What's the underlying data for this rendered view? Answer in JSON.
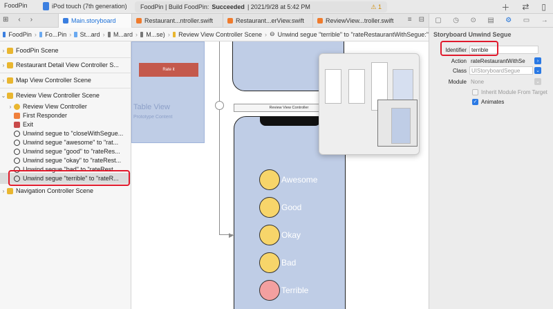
{
  "toolbar": {
    "scheme": "FoodPin",
    "device": "iPod touch (7th generation)",
    "status_prefix": "FoodPin | Build FoodPin:",
    "status_state": "Succeeded",
    "status_time": "| 2021/9/28 at 5:42 PM",
    "warnings": "⚠ 1"
  },
  "tabs": [
    {
      "label": "Main.storyboard",
      "active": true
    },
    {
      "label": "Restaurant...ntroller.swift",
      "active": false
    },
    {
      "label": "Restaurant...erView.swift",
      "active": false
    },
    {
      "label": "ReviewView...troller.swift",
      "active": false
    }
  ],
  "breadcrumb": [
    "FoodPin",
    "Fo...Pin",
    "St...ard",
    "M...ard",
    "M...se)",
    "Review View Controller Scene",
    "Unwind segue \"terrible\" to \"rateRestaurantWithSegue:\""
  ],
  "outline": {
    "items": [
      {
        "label": "FoodPin Scene"
      },
      {
        "label": "Restaurant Detail View Controller S..."
      },
      {
        "label": "Map View Controller Scene"
      },
      {
        "label": "Review View Controller Scene"
      },
      {
        "label": "Review View Controller"
      },
      {
        "label": "First Responder"
      },
      {
        "label": "Exit"
      },
      {
        "label": "Unwind segue to \"closeWithSegue..."
      },
      {
        "label": "Unwind segue \"awesome\" to \"rat..."
      },
      {
        "label": "Unwind segue \"good\" to \"rateRes..."
      },
      {
        "label": "Unwind segue \"okay\" to \"rateRest..."
      },
      {
        "label": "Unwind segue \"bad\" to \"rateRest..."
      },
      {
        "label": "Unwind segue \"terrible\" to \"rateR..."
      },
      {
        "label": "Navigation Controller Scene"
      }
    ]
  },
  "canvas": {
    "rate_button": "Rate it",
    "table_view": "Table View",
    "prototype_content": "Prototype Content",
    "scene_title": "Review View Controller",
    "ratings": [
      "Awesome",
      "Good",
      "Okay",
      "Bad",
      "Terrible"
    ]
  },
  "inspector": {
    "title": "Storyboard Unwind Segue",
    "identifier_label": "Identifier",
    "identifier_value": "terrible",
    "action_label": "Action",
    "action_value": "rateRestaurantWithSe",
    "class_label": "Class",
    "class_placeholder": "UIStoryboardSegue",
    "module_label": "Module",
    "module_placeholder": "None",
    "inherit_label": "Inherit Module From Target",
    "animates_label": "Animates"
  },
  "colors": {
    "accent": "#1a6fd8",
    "highlight": "#e0192b",
    "scene_bg": "#bfcde6"
  }
}
